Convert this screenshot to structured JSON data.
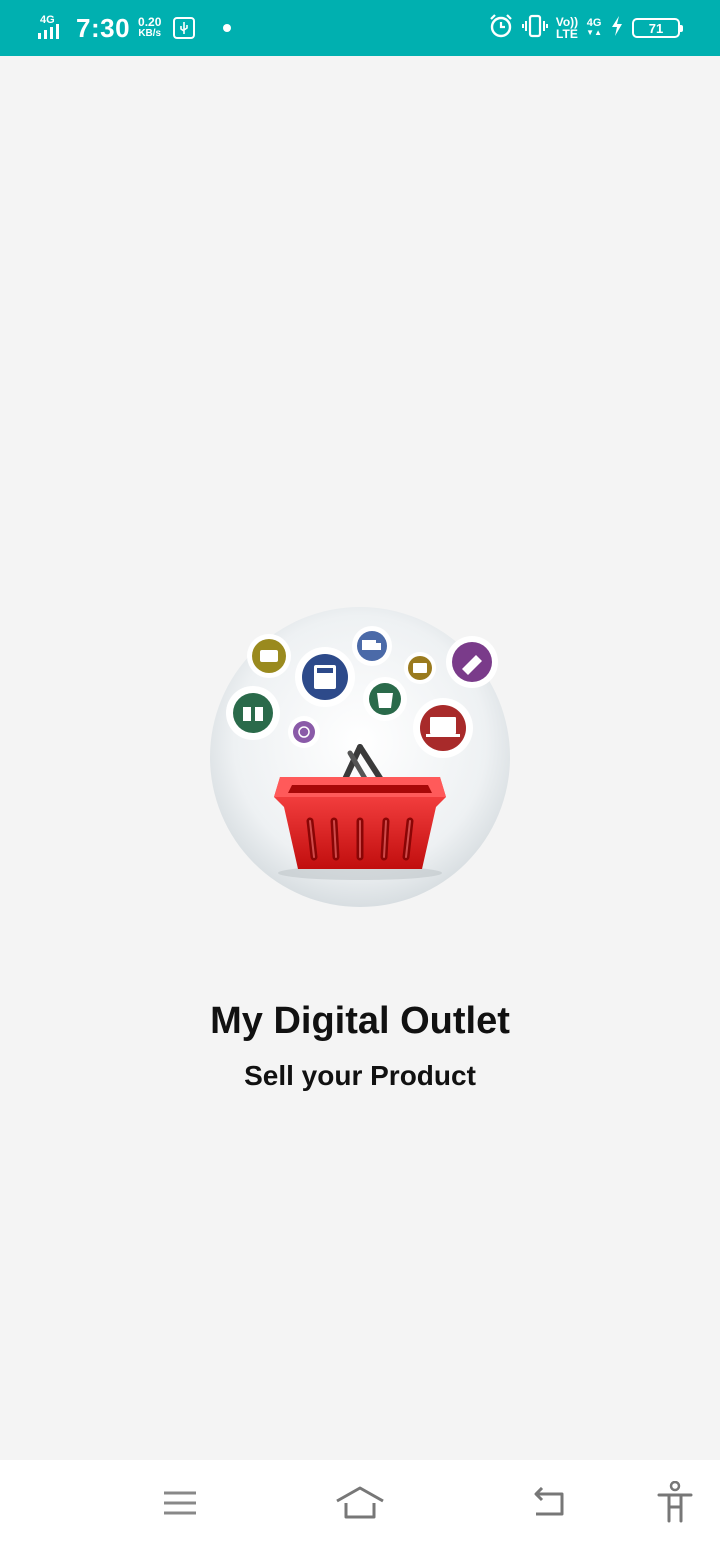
{
  "status_bar": {
    "network_type": "4G",
    "time": "7:30",
    "speed_value": "0.20",
    "speed_unit": "KB/s",
    "volte_top": "Vo))",
    "volte_bottom": "LTE",
    "network_right": "4G",
    "battery_level": "71",
    "icons": [
      "signal-icon",
      "usb-icon",
      "notification-dot",
      "alarm-icon",
      "vibrate-icon",
      "charging-icon",
      "battery-icon"
    ]
  },
  "splash": {
    "title": "My Digital Outlet",
    "subtitle": "Sell your Product",
    "logo_icons": [
      "wallet-icon",
      "calculator-icon",
      "delivery-truck-icon",
      "card-icon",
      "gift-icon",
      "shopping-bag-icon",
      "laptop-cart-icon",
      "phone-icon",
      "tag-icon",
      "shopping-basket-icon"
    ]
  },
  "nav_bar": {
    "icons": [
      "menu-icon",
      "home-icon",
      "back-icon",
      "accessibility-icon"
    ]
  },
  "colors": {
    "status_bar": "#00b0b0",
    "background": "#f4f4f4",
    "basket_red": "#e01f1f"
  }
}
